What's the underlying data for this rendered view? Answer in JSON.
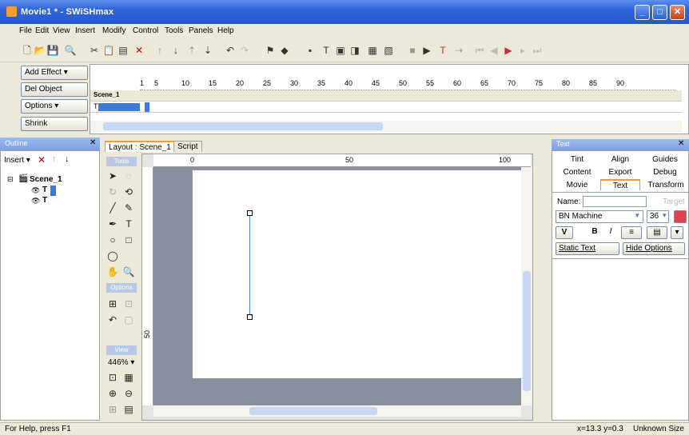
{
  "window": {
    "title": "Movie1 * - SWiSHmax",
    "minimize": "_",
    "maximize": "□",
    "close": "✕"
  },
  "menu": [
    "File",
    "Edit",
    "View",
    "Insert",
    "Modify",
    "Control",
    "Tools",
    "Panels",
    "Help"
  ],
  "timeline": {
    "buttons": [
      "Add Effect ▾",
      "Del Object",
      "Options ▾",
      "Shrink"
    ],
    "ruler": [
      "1",
      "5",
      "10",
      "15",
      "20",
      "25",
      "30",
      "35",
      "40",
      "45",
      "50",
      "55",
      "60",
      "65",
      "70",
      "75",
      "80",
      "85",
      "90"
    ],
    "scene_row": "Scene_1",
    "text_row": "T"
  },
  "outline": {
    "title": "Outline",
    "insert_label": "Insert ▾",
    "scene_label": "Scene_1",
    "item1": "T",
    "item2": "T"
  },
  "layout": {
    "tab_layout": "Layout : Scene_1",
    "tab_script": "Script",
    "ruler": [
      "0",
      "50",
      "100"
    ],
    "vruler": "50"
  },
  "tools": {
    "head_tools": "Tools",
    "head_options": "Options",
    "head_view": "View",
    "zoom": "446% ▾"
  },
  "text_panel": {
    "title": "Text",
    "tabs_row1": [
      "Tint",
      "Align",
      "Guides"
    ],
    "tabs_row2": [
      "Content",
      "Export",
      "Debug"
    ],
    "tabs_row3": [
      "Movie",
      "Text",
      "Transform"
    ],
    "name_label": "Name:",
    "target_label": "Target",
    "font": "BN Machine",
    "size": "36",
    "text_type": "Static Text",
    "hide_options": "Hide Options"
  },
  "status": {
    "help": "For Help, press F1",
    "coords": "x=13.3 y=0.3",
    "size": "Unknown Size"
  }
}
